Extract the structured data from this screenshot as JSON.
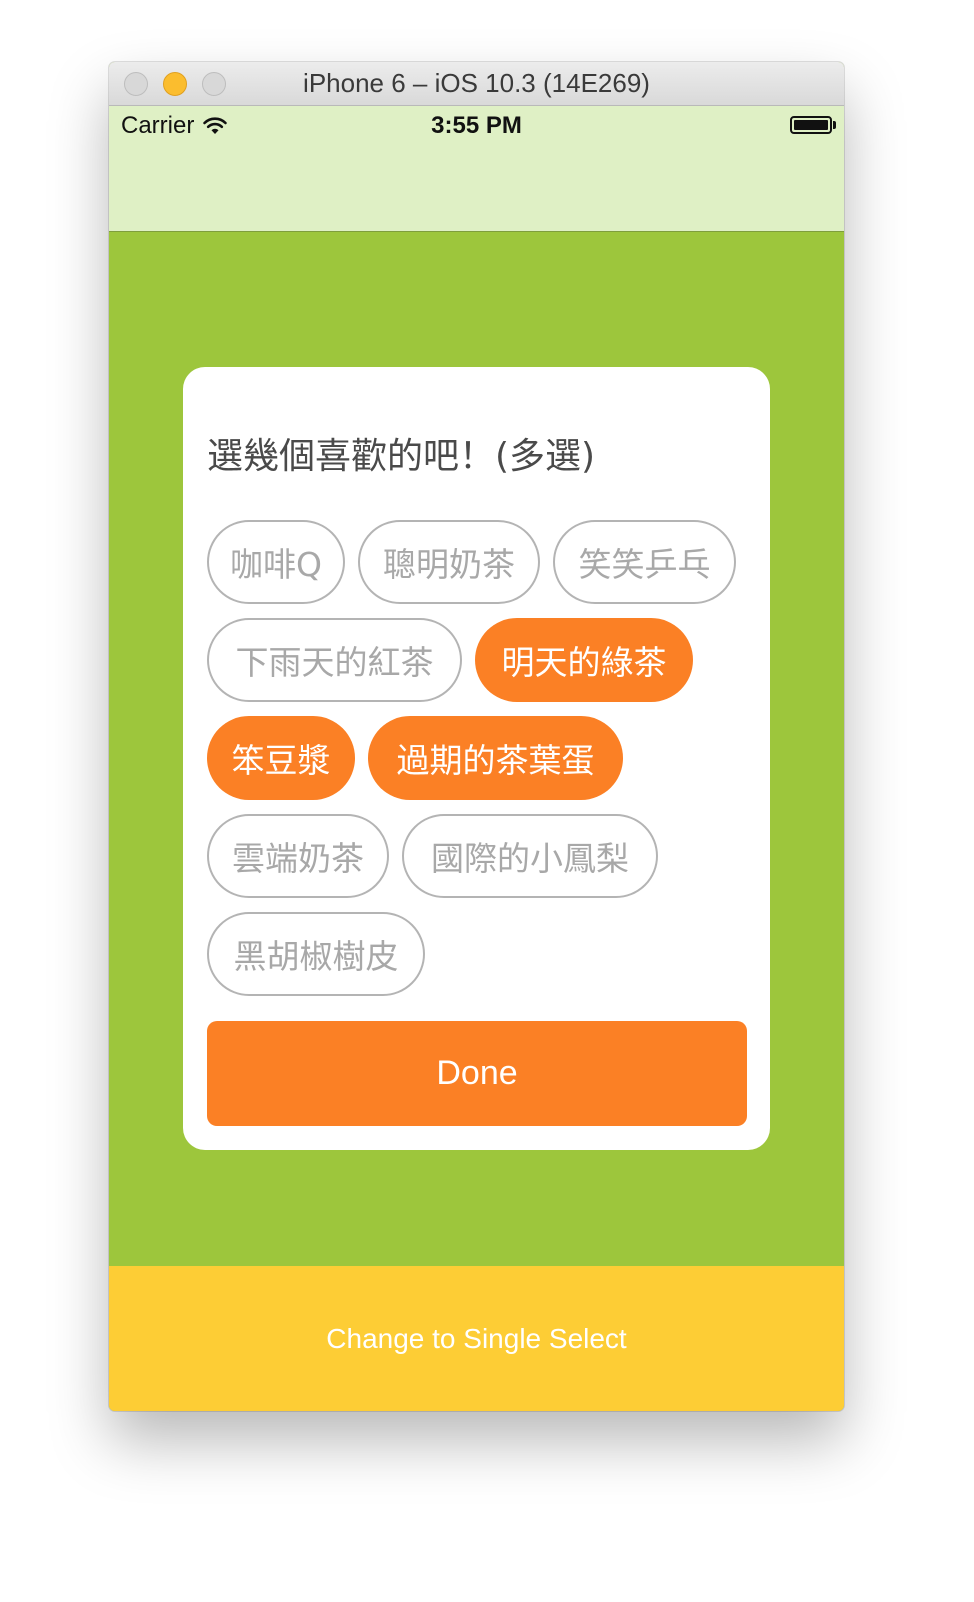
{
  "window": {
    "title": "iPhone 6 – iOS 10.3 (14E269)"
  },
  "status_bar": {
    "carrier": "Carrier",
    "time": "3:55 PM",
    "wifi_icon": "wifi-icon",
    "battery_level": 1.0
  },
  "dialog": {
    "prompt": "選幾個喜歡的吧！(多選)",
    "options": [
      {
        "label": "咖啡Q",
        "selected": false
      },
      {
        "label": "聰明奶茶",
        "selected": false
      },
      {
        "label": "笑笑乒乓",
        "selected": false
      },
      {
        "label": "下雨天的紅茶",
        "selected": false
      },
      {
        "label": "明天的綠茶",
        "selected": true
      },
      {
        "label": "笨豆漿",
        "selected": true
      },
      {
        "label": "過期的茶葉蛋",
        "selected": true
      },
      {
        "label": "雲端奶茶",
        "selected": false
      },
      {
        "label": "國際的小鳳梨",
        "selected": false
      },
      {
        "label": "黑胡椒樹皮",
        "selected": false
      }
    ],
    "done_label": "Done"
  },
  "bottom_bar": {
    "label": "Change to Single Select"
  },
  "colors": {
    "background_green": "#9dc63c",
    "header_green": "#dff0c5",
    "accent_orange": "#fb8025",
    "bottom_yellow": "#fdcd35",
    "tag_border": "#b4b4b4",
    "tag_text": "#a8a8a8"
  }
}
